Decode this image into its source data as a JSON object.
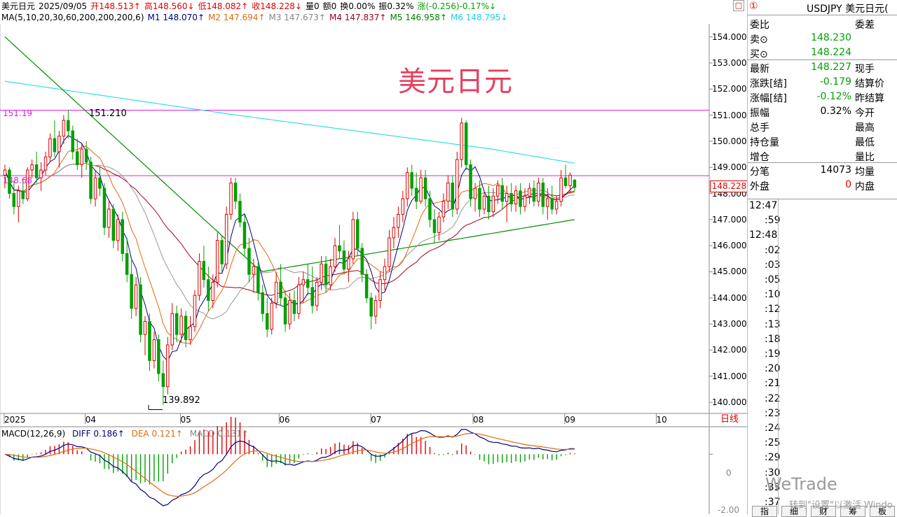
{
  "header": {
    "line1": [
      {
        "text": "美元日元",
        "color": "#000000"
      },
      {
        "text": "2025/09/05",
        "color": "#000000"
      },
      {
        "text": "开148.513↑",
        "color": "#e00000"
      },
      {
        "text": "高148.560↓",
        "color": "#e00000"
      },
      {
        "text": "低148.082↑",
        "color": "#e00000"
      },
      {
        "text": "收148.228↓",
        "color": "#e00000"
      },
      {
        "text": "量0",
        "color": "#000000"
      },
      {
        "text": "额0",
        "color": "#000000"
      },
      {
        "text": "换0.00%",
        "color": "#000000"
      },
      {
        "text": "振0.32%",
        "color": "#000000"
      },
      {
        "text": "涨(-0.256)-0.17%↓",
        "color": "#00a000"
      }
    ],
    "line2": [
      {
        "text": "MA(5,10,20,30,60,200,200,200,6)",
        "color": "#000000"
      },
      {
        "text": "M1 148.070↑",
        "color": "#000080"
      },
      {
        "text": "M2 147.694↑",
        "color": "#e06a10"
      },
      {
        "text": "M3 147.673↑",
        "color": "#888888"
      },
      {
        "text": "M4 147.837↑",
        "color": "#a00020"
      },
      {
        "text": "M5 146.958↑",
        "color": "#008000"
      },
      {
        "text": "M6 148.795↓",
        "color": "#20d0e0"
      }
    ]
  },
  "chart_title": "美元日元",
  "price_axis": [
    "154.000",
    "153.000",
    "152.000",
    "151.000",
    "150.000",
    "149.000",
    "148.000",
    "147.000",
    "146.000",
    "145.000",
    "144.000",
    "143.000",
    "142.000",
    "141.000",
    "140.000"
  ],
  "current_price_tag": "148.228",
  "hline_labels": {
    "upper": "151.19",
    "lower": "148.68"
  },
  "annotations": {
    "high": "151.210",
    "low": "139.892"
  },
  "date_labels": [
    "2025",
    "04",
    "05",
    "06",
    "07",
    "08",
    "09",
    "10"
  ],
  "period_button": "日线",
  "restore_icon": "□",
  "macd": {
    "params": "MACD(12,26,9)",
    "diff": "DIFF 0.186↑",
    "dea": "DEA 0.121↑",
    "macd": "MACD 0.131↑",
    "axis": [
      "0",
      "-2.00"
    ]
  },
  "panel": {
    "symbol": "USDJPY 美元日元(",
    "badge": "①",
    "rows": [
      {
        "l": "委比",
        "v": "",
        "l2": "委差"
      },
      {
        "l": "卖⊙",
        "v": "148.230",
        "l2": ""
      },
      {
        "l": "买⊙",
        "v": "148.224",
        "l2": ""
      },
      {
        "l": "最新",
        "v": "148.227",
        "l2": "现手"
      },
      {
        "l": "涨跌[结]",
        "v": "-0.179",
        "l2": "结算价"
      },
      {
        "l": "涨幅[结]",
        "v": "-0.12%",
        "l2": "昨结算"
      },
      {
        "l": "振幅",
        "v": "0.32%",
        "l2": "今开"
      },
      {
        "l": "总手",
        "v": "",
        "l2": "最高"
      },
      {
        "l": "持仓量",
        "v": "",
        "l2": "最低"
      },
      {
        "l": "增仓",
        "v": "",
        "l2": "量比"
      },
      {
        "l": "分笔",
        "v": "14073",
        "l2": "均量"
      },
      {
        "l": "外盘",
        "v": "0",
        "l2": "内盘"
      }
    ],
    "ticks": [
      "12:47",
      ":59",
      "12:48",
      ":02",
      ":03",
      ":05",
      ":10",
      ":12",
      ":13",
      ":18",
      ":19",
      ":20",
      ":21",
      ":22",
      ":23",
      ":24",
      ":25",
      ":29",
      ":30",
      ":35",
      ":37"
    ],
    "tabs": [
      "指",
      "细",
      "财",
      "筹",
      "板"
    ]
  },
  "watermark": "WeTrade",
  "activate_text": "转到\"设置\"以激活 Windo",
  "colors": {
    "up": "#e00000",
    "down": "#00a000",
    "hline": "#e020e0",
    "ma_fast": "#000080",
    "ma_orange": "#e06a10",
    "ma_gray": "#999999",
    "ma_red": "#a00020",
    "ma_green": "#009000",
    "ma_cyan": "#30e0e8",
    "macd_diff": "#000080",
    "macd_dea": "#e06a10"
  },
  "chart_data": {
    "type": "candlestick",
    "instrument": "美元日元",
    "ylim": [
      139.6,
      154.5
    ],
    "horizontal_levels": [
      151.19,
      148.68
    ],
    "candles": [
      {
        "o": 148.7,
        "h": 149.1,
        "l": 148.2,
        "c": 148.9
      },
      {
        "o": 148.9,
        "h": 149.0,
        "l": 147.8,
        "c": 148.0
      },
      {
        "o": 148.0,
        "h": 148.5,
        "l": 147.2,
        "c": 147.5
      },
      {
        "o": 147.5,
        "h": 148.3,
        "l": 146.9,
        "c": 148.1
      },
      {
        "o": 148.1,
        "h": 148.6,
        "l": 147.6,
        "c": 147.8
      },
      {
        "o": 147.8,
        "h": 149.0,
        "l": 147.7,
        "c": 148.9
      },
      {
        "o": 148.9,
        "h": 149.3,
        "l": 148.6,
        "c": 149.1
      },
      {
        "o": 149.1,
        "h": 149.6,
        "l": 148.4,
        "c": 148.6
      },
      {
        "o": 148.6,
        "h": 149.2,
        "l": 148.1,
        "c": 148.9
      },
      {
        "o": 148.9,
        "h": 149.6,
        "l": 148.7,
        "c": 149.4
      },
      {
        "o": 149.4,
        "h": 150.3,
        "l": 149.2,
        "c": 150.1
      },
      {
        "o": 150.1,
        "h": 150.8,
        "l": 149.4,
        "c": 149.6
      },
      {
        "o": 149.6,
        "h": 150.4,
        "l": 149.0,
        "c": 150.2
      },
      {
        "o": 150.2,
        "h": 151.0,
        "l": 149.9,
        "c": 150.8
      },
      {
        "o": 150.8,
        "h": 151.2,
        "l": 150.1,
        "c": 150.4
      },
      {
        "o": 150.4,
        "h": 150.6,
        "l": 149.3,
        "c": 149.6
      },
      {
        "o": 149.6,
        "h": 150.1,
        "l": 148.9,
        "c": 149.1
      },
      {
        "o": 149.1,
        "h": 149.9,
        "l": 148.6,
        "c": 149.7
      },
      {
        "o": 149.7,
        "h": 150.0,
        "l": 148.9,
        "c": 149.2
      },
      {
        "o": 149.2,
        "h": 149.4,
        "l": 147.6,
        "c": 147.8
      },
      {
        "o": 147.8,
        "h": 148.9,
        "l": 147.5,
        "c": 148.6
      },
      {
        "o": 148.6,
        "h": 149.0,
        "l": 147.9,
        "c": 148.2
      },
      {
        "o": 148.2,
        "h": 148.4,
        "l": 146.4,
        "c": 146.7
      },
      {
        "o": 146.7,
        "h": 147.7,
        "l": 146.3,
        "c": 147.4
      },
      {
        "o": 147.4,
        "h": 147.6,
        "l": 145.9,
        "c": 146.2
      },
      {
        "o": 146.2,
        "h": 147.2,
        "l": 145.8,
        "c": 147.0
      },
      {
        "o": 147.0,
        "h": 147.3,
        "l": 145.4,
        "c": 145.7
      },
      {
        "o": 145.7,
        "h": 146.3,
        "l": 144.6,
        "c": 144.9
      },
      {
        "o": 144.9,
        "h": 145.5,
        "l": 143.2,
        "c": 143.6
      },
      {
        "o": 143.6,
        "h": 144.8,
        "l": 143.3,
        "c": 144.5
      },
      {
        "o": 144.5,
        "h": 144.8,
        "l": 142.3,
        "c": 142.6
      },
      {
        "o": 142.6,
        "h": 143.3,
        "l": 141.8,
        "c": 143.1
      },
      {
        "o": 143.1,
        "h": 143.4,
        "l": 141.2,
        "c": 141.6
      },
      {
        "o": 141.6,
        "h": 142.7,
        "l": 141.3,
        "c": 142.4
      },
      {
        "o": 142.4,
        "h": 142.6,
        "l": 140.8,
        "c": 141.1
      },
      {
        "o": 141.1,
        "h": 141.6,
        "l": 139.9,
        "c": 140.6
      },
      {
        "o": 140.6,
        "h": 142.5,
        "l": 140.3,
        "c": 142.2
      },
      {
        "o": 142.2,
        "h": 143.8,
        "l": 142.0,
        "c": 143.4
      },
      {
        "o": 143.4,
        "h": 143.7,
        "l": 142.3,
        "c": 142.6
      },
      {
        "o": 142.6,
        "h": 143.6,
        "l": 142.3,
        "c": 143.3
      },
      {
        "o": 143.3,
        "h": 143.5,
        "l": 142.1,
        "c": 142.4
      },
      {
        "o": 142.4,
        "h": 143.3,
        "l": 142.2,
        "c": 142.9
      },
      {
        "o": 142.9,
        "h": 144.3,
        "l": 142.7,
        "c": 144.1
      },
      {
        "o": 144.1,
        "h": 145.7,
        "l": 143.9,
        "c": 145.4
      },
      {
        "o": 145.4,
        "h": 146.0,
        "l": 144.4,
        "c": 144.7
      },
      {
        "o": 144.7,
        "h": 145.2,
        "l": 143.5,
        "c": 143.9
      },
      {
        "o": 143.9,
        "h": 144.9,
        "l": 143.6,
        "c": 144.6
      },
      {
        "o": 144.6,
        "h": 146.5,
        "l": 144.4,
        "c": 146.2
      },
      {
        "o": 146.2,
        "h": 146.4,
        "l": 145.0,
        "c": 145.3
      },
      {
        "o": 145.3,
        "h": 147.5,
        "l": 145.1,
        "c": 147.2
      },
      {
        "o": 147.2,
        "h": 148.6,
        "l": 147.0,
        "c": 148.4
      },
      {
        "o": 148.4,
        "h": 148.6,
        "l": 147.4,
        "c": 147.7
      },
      {
        "o": 147.7,
        "h": 148.0,
        "l": 146.7,
        "c": 146.9
      },
      {
        "o": 146.9,
        "h": 147.2,
        "l": 145.6,
        "c": 145.9
      },
      {
        "o": 145.9,
        "h": 146.3,
        "l": 144.6,
        "c": 144.9
      },
      {
        "o": 144.9,
        "h": 145.5,
        "l": 144.2,
        "c": 145.2
      },
      {
        "o": 145.2,
        "h": 145.4,
        "l": 143.9,
        "c": 144.2
      },
      {
        "o": 144.2,
        "h": 144.5,
        "l": 143.1,
        "c": 143.4
      },
      {
        "o": 143.4,
        "h": 144.0,
        "l": 142.5,
        "c": 142.8
      },
      {
        "o": 142.8,
        "h": 144.0,
        "l": 142.6,
        "c": 143.8
      },
      {
        "o": 143.8,
        "h": 145.0,
        "l": 143.6,
        "c": 144.6
      },
      {
        "o": 144.6,
        "h": 145.3,
        "l": 143.7,
        "c": 144.0
      },
      {
        "o": 144.0,
        "h": 144.3,
        "l": 142.7,
        "c": 143.0
      },
      {
        "o": 143.0,
        "h": 144.2,
        "l": 142.8,
        "c": 143.9
      },
      {
        "o": 143.9,
        "h": 144.3,
        "l": 143.1,
        "c": 143.4
      },
      {
        "o": 143.4,
        "h": 144.8,
        "l": 143.2,
        "c": 144.5
      },
      {
        "o": 144.5,
        "h": 145.0,
        "l": 143.8,
        "c": 144.7
      },
      {
        "o": 144.7,
        "h": 145.3,
        "l": 144.1,
        "c": 144.4
      },
      {
        "o": 144.4,
        "h": 145.2,
        "l": 143.4,
        "c": 143.7
      },
      {
        "o": 143.7,
        "h": 144.8,
        "l": 143.5,
        "c": 144.6
      },
      {
        "o": 144.6,
        "h": 145.6,
        "l": 144.3,
        "c": 145.3
      },
      {
        "o": 145.3,
        "h": 145.6,
        "l": 144.2,
        "c": 144.5
      },
      {
        "o": 144.5,
        "h": 145.5,
        "l": 144.3,
        "c": 145.2
      },
      {
        "o": 145.2,
        "h": 146.3,
        "l": 145.0,
        "c": 146.0
      },
      {
        "o": 146.0,
        "h": 146.8,
        "l": 145.5,
        "c": 145.8
      },
      {
        "o": 145.8,
        "h": 146.2,
        "l": 144.9,
        "c": 145.1
      },
      {
        "o": 145.1,
        "h": 145.8,
        "l": 144.6,
        "c": 145.5
      },
      {
        "o": 145.5,
        "h": 147.3,
        "l": 145.3,
        "c": 147.0
      },
      {
        "o": 147.0,
        "h": 147.3,
        "l": 145.6,
        "c": 145.9
      },
      {
        "o": 145.9,
        "h": 146.1,
        "l": 144.6,
        "c": 144.9
      },
      {
        "o": 144.9,
        "h": 145.1,
        "l": 143.8,
        "c": 144.0
      },
      {
        "o": 144.0,
        "h": 144.2,
        "l": 142.8,
        "c": 143.3
      },
      {
        "o": 143.3,
        "h": 144.1,
        "l": 143.0,
        "c": 143.9
      },
      {
        "o": 143.9,
        "h": 145.0,
        "l": 143.6,
        "c": 144.7
      },
      {
        "o": 144.7,
        "h": 145.5,
        "l": 144.3,
        "c": 145.2
      },
      {
        "o": 145.2,
        "h": 146.6,
        "l": 145.0,
        "c": 146.3
      },
      {
        "o": 146.3,
        "h": 147.1,
        "l": 145.9,
        "c": 146.7
      },
      {
        "o": 146.7,
        "h": 147.5,
        "l": 146.3,
        "c": 147.2
      },
      {
        "o": 147.2,
        "h": 148.1,
        "l": 146.9,
        "c": 147.8
      },
      {
        "o": 147.8,
        "h": 149.0,
        "l": 147.5,
        "c": 148.8
      },
      {
        "o": 148.8,
        "h": 149.1,
        "l": 147.9,
        "c": 148.2
      },
      {
        "o": 148.2,
        "h": 148.8,
        "l": 147.4,
        "c": 147.7
      },
      {
        "o": 147.7,
        "h": 148.9,
        "l": 147.6,
        "c": 148.6
      },
      {
        "o": 148.6,
        "h": 148.9,
        "l": 147.5,
        "c": 147.8
      },
      {
        "o": 147.8,
        "h": 148.1,
        "l": 146.7,
        "c": 147.0
      },
      {
        "o": 147.0,
        "h": 147.4,
        "l": 146.1,
        "c": 146.5
      },
      {
        "o": 146.5,
        "h": 147.3,
        "l": 146.2,
        "c": 147.1
      },
      {
        "o": 147.1,
        "h": 148.0,
        "l": 146.9,
        "c": 147.7
      },
      {
        "o": 147.7,
        "h": 148.7,
        "l": 147.4,
        "c": 148.4
      },
      {
        "o": 148.4,
        "h": 148.7,
        "l": 147.1,
        "c": 147.4
      },
      {
        "o": 147.4,
        "h": 149.6,
        "l": 147.2,
        "c": 149.3
      },
      {
        "o": 149.3,
        "h": 150.9,
        "l": 149.0,
        "c": 150.7
      },
      {
        "o": 150.7,
        "h": 150.8,
        "l": 148.9,
        "c": 149.1
      },
      {
        "o": 149.1,
        "h": 149.3,
        "l": 147.5,
        "c": 147.8
      },
      {
        "o": 147.8,
        "h": 148.4,
        "l": 147.3,
        "c": 148.2
      },
      {
        "o": 148.2,
        "h": 148.5,
        "l": 147.1,
        "c": 147.4
      },
      {
        "o": 147.4,
        "h": 148.1,
        "l": 147.2,
        "c": 147.9
      },
      {
        "o": 147.9,
        "h": 148.3,
        "l": 147.0,
        "c": 147.3
      },
      {
        "o": 147.3,
        "h": 148.2,
        "l": 147.1,
        "c": 147.9
      },
      {
        "o": 147.9,
        "h": 148.5,
        "l": 147.6,
        "c": 148.3
      },
      {
        "o": 148.3,
        "h": 148.6,
        "l": 147.4,
        "c": 147.7
      },
      {
        "o": 147.7,
        "h": 148.3,
        "l": 146.9,
        "c": 148.0
      },
      {
        "o": 148.0,
        "h": 148.4,
        "l": 147.3,
        "c": 147.6
      },
      {
        "o": 147.6,
        "h": 148.3,
        "l": 147.3,
        "c": 148.1
      },
      {
        "o": 148.1,
        "h": 148.4,
        "l": 147.2,
        "c": 147.5
      },
      {
        "o": 147.5,
        "h": 148.2,
        "l": 147.3,
        "c": 147.9
      },
      {
        "o": 147.9,
        "h": 148.4,
        "l": 147.6,
        "c": 148.2
      },
      {
        "o": 148.2,
        "h": 148.5,
        "l": 147.5,
        "c": 147.7
      },
      {
        "o": 147.7,
        "h": 148.6,
        "l": 147.5,
        "c": 148.4
      },
      {
        "o": 148.4,
        "h": 148.6,
        "l": 147.2,
        "c": 147.5
      },
      {
        "o": 147.5,
        "h": 148.2,
        "l": 147.0,
        "c": 147.8
      },
      {
        "o": 147.8,
        "h": 148.3,
        "l": 147.2,
        "c": 147.4
      },
      {
        "o": 147.4,
        "h": 147.9,
        "l": 147.2,
        "c": 147.7
      },
      {
        "o": 147.7,
        "h": 148.9,
        "l": 147.5,
        "c": 148.6
      },
      {
        "o": 148.6,
        "h": 149.1,
        "l": 148.2,
        "c": 148.3
      },
      {
        "o": 148.3,
        "h": 148.8,
        "l": 148.0,
        "c": 148.7
      },
      {
        "o": 148.513,
        "h": 148.56,
        "l": 148.082,
        "c": 148.228
      }
    ],
    "macd_range": [
      -2.3,
      1.0
    ]
  }
}
